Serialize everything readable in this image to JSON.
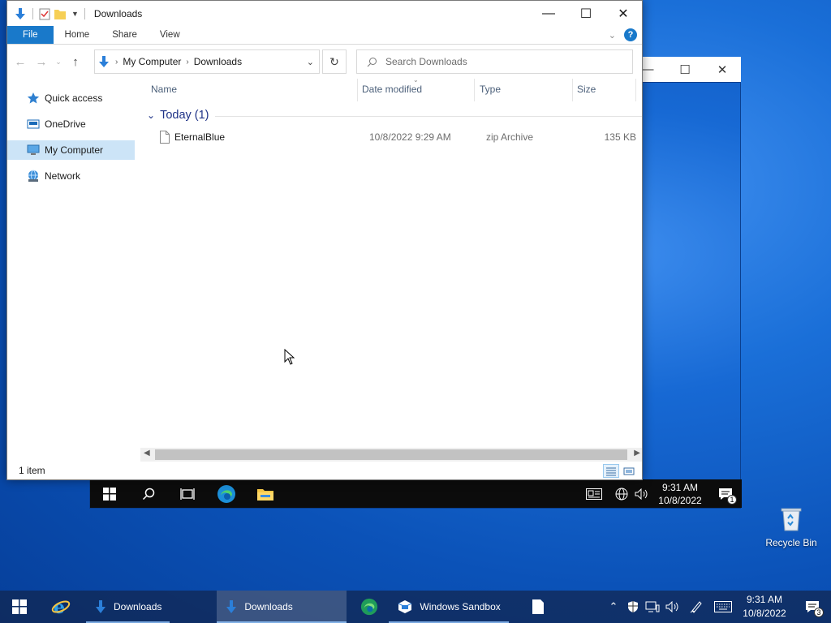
{
  "desktop": {
    "recycle_bin_label": "Recycle Bin"
  },
  "explorer": {
    "title": "Downloads",
    "ribbon_tabs": [
      "File",
      "Home",
      "Share",
      "View"
    ],
    "address": {
      "root": "My Computer",
      "current": "Downloads"
    },
    "search_placeholder": "Search Downloads",
    "nav_items": [
      {
        "label": "Quick access",
        "icon": "star-icon"
      },
      {
        "label": "OneDrive",
        "icon": "onedrive-icon"
      },
      {
        "label": "My Computer",
        "icon": "computer-icon",
        "selected": true
      },
      {
        "label": "Network",
        "icon": "network-icon"
      }
    ],
    "columns": [
      "Name",
      "Date modified",
      "Type",
      "Size"
    ],
    "group_header": "Today (1)",
    "files": [
      {
        "name": "EternalBlue",
        "date_modified": "10/8/2022 9:29 AM",
        "type": "zip Archive",
        "size": "135 KB"
      }
    ],
    "status": "1 item"
  },
  "sandbox": {
    "clock_time": "9:31 AM",
    "clock_date": "10/8/2022",
    "notification_count": "1"
  },
  "taskbar": {
    "apps": [
      {
        "label": "Downloads",
        "active": false
      },
      {
        "label": "Downloads",
        "active": true
      },
      {
        "label": "Windows Sandbox",
        "active": false
      }
    ],
    "clock_time": "9:31 AM",
    "clock_date": "10/8/2022",
    "notification_count": "3"
  },
  "colors": {
    "accent": "#1979ca",
    "folder_blue": "#1e3287",
    "selection": "#cce4f7"
  }
}
